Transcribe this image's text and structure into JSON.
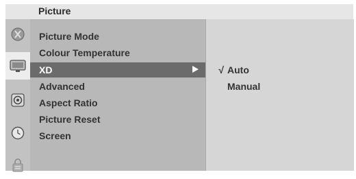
{
  "osd": {
    "title": "Picture",
    "icons": [
      {
        "name": "picture-tool-icon",
        "active": false
      },
      {
        "name": "tv-screen-icon",
        "active": true
      },
      {
        "name": "speaker-icon",
        "active": false
      },
      {
        "name": "clock-icon",
        "active": false
      },
      {
        "name": "lock-icon",
        "active": false
      }
    ],
    "menu": {
      "items": [
        {
          "label": "Picture Mode",
          "selected": false
        },
        {
          "label": "Colour Temperature",
          "selected": false
        },
        {
          "label": "XD",
          "selected": true
        },
        {
          "label": "Advanced",
          "selected": false
        },
        {
          "label": "Aspect Ratio",
          "selected": false
        },
        {
          "label": "Picture Reset",
          "selected": false
        },
        {
          "label": "Screen",
          "selected": false
        }
      ]
    },
    "submenu": {
      "check_mark": "√",
      "options": [
        {
          "label": "Auto",
          "checked": true
        },
        {
          "label": "Manual",
          "checked": false
        }
      ]
    }
  }
}
